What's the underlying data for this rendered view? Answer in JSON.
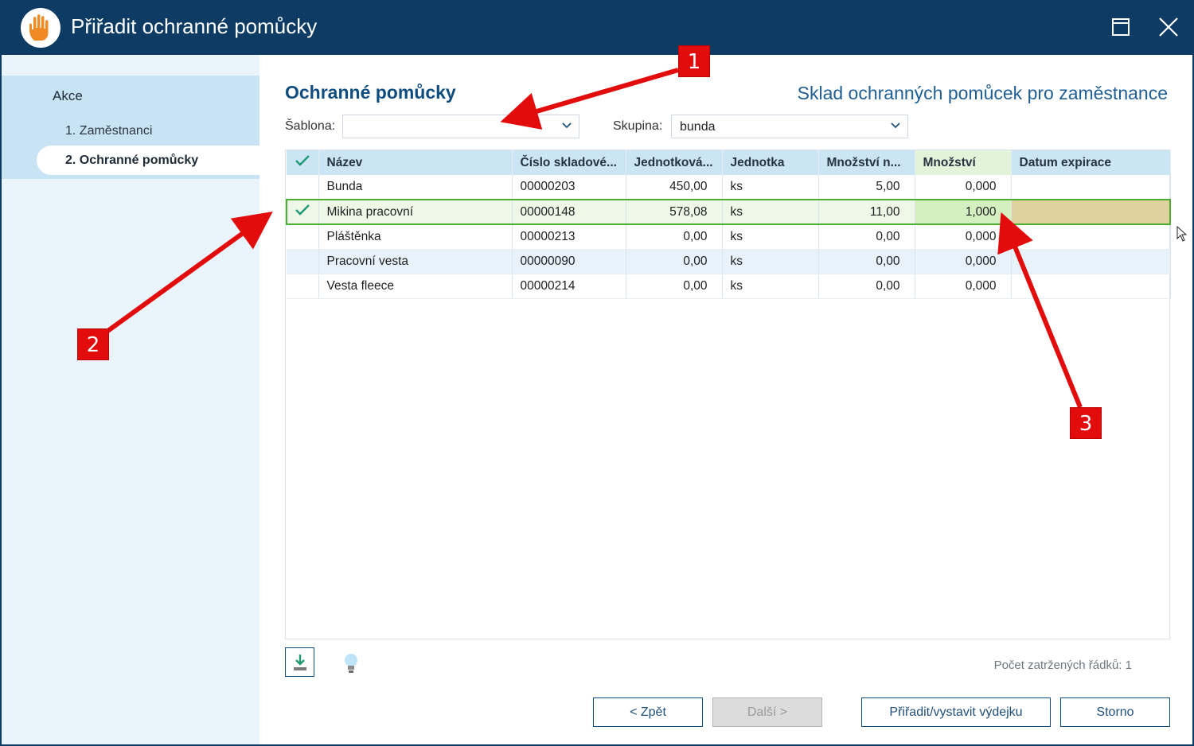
{
  "window": {
    "title": "Přiřadit ochranné pomůcky",
    "app_icon": "hand-icon"
  },
  "sidebar": {
    "title": "Akce",
    "items": [
      {
        "label": "1. Zaměstnanci"
      },
      {
        "label": "2. Ochranné pomůcky"
      }
    ]
  },
  "main": {
    "title": "Ochranné pomůcky",
    "subtitle": "Sklad ochranných pomůcek pro zaměstnance",
    "template_label": "Šablona:",
    "template_value": "",
    "group_label": "Skupina:",
    "group_value": "bunda"
  },
  "grid": {
    "columns": [
      "Název",
      "Číslo skladové...",
      "Jednotková...",
      "Jednotka",
      "Množství n...",
      "Množství",
      "Datum expirace"
    ],
    "rows": [
      {
        "checked": false,
        "name": "Bunda",
        "code": "00000203",
        "unit_price": "450,00",
        "unit": "ks",
        "qty_n": "5,00",
        "qty": "0,000",
        "expiry": ""
      },
      {
        "checked": true,
        "name": "Mikina pracovní",
        "code": "00000148",
        "unit_price": "578,08",
        "unit": "ks",
        "qty_n": "11,00",
        "qty": "1,000",
        "expiry": ""
      },
      {
        "checked": false,
        "name": "Pláštěnka",
        "code": "00000213",
        "unit_price": "0,00",
        "unit": "ks",
        "qty_n": "0,00",
        "qty": "0,000",
        "expiry": ""
      },
      {
        "checked": false,
        "name": "Pracovní vesta",
        "code": "00000090",
        "unit_price": "0,00",
        "unit": "ks",
        "qty_n": "0,00",
        "qty": "0,000",
        "expiry": ""
      },
      {
        "checked": false,
        "name": "Vesta fleece",
        "code": "00000214",
        "unit_price": "0,00",
        "unit": "ks",
        "qty_n": "0,00",
        "qty": "0,000",
        "expiry": ""
      }
    ]
  },
  "footer": {
    "checked_count": "Počet zatržených řádků: 1",
    "back_label": "< Zpět",
    "next_label": "Další >",
    "assign_label": "Přiřadit/vystavit výdejku",
    "cancel_label": "Storno"
  },
  "annotations": [
    "1",
    "2",
    "3"
  ],
  "colors": {
    "titlebar": "#0d3b63",
    "accent": "#0f4c80",
    "selection": "#4caf32",
    "annotation": "#e30c0c"
  }
}
